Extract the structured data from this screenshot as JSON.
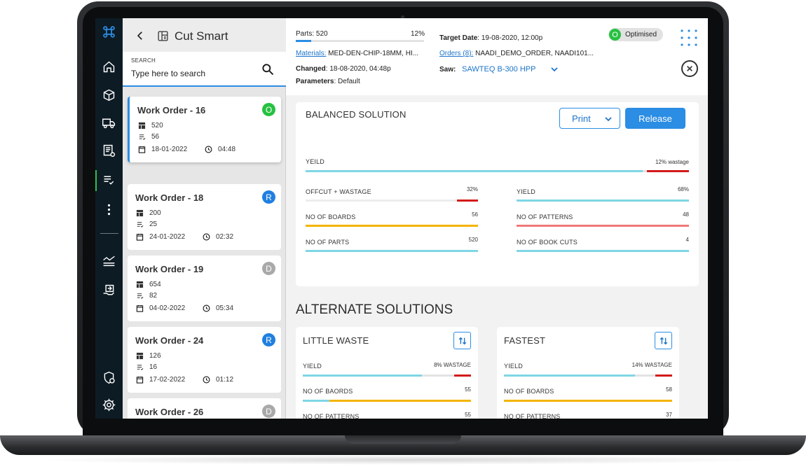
{
  "app": {
    "title": "Cut Smart",
    "search_caption": "SEARCH",
    "search_placeholder": "Type here to search"
  },
  "rail": {
    "items": [
      "app-logo-icon",
      "home-icon",
      "box-icon",
      "truck-icon",
      "report-icon",
      "checklist-icon",
      "more-icon",
      "analytics-icon",
      "handover-icon",
      "shield-icon",
      "settings-icon"
    ],
    "active": "checklist-icon"
  },
  "work_orders": [
    {
      "title": "Work Order - 16",
      "badge": "O",
      "badge_color": "#27c141",
      "boards": "520",
      "parts": "56",
      "date": "18-01-2022",
      "time": "04:48",
      "selected": true
    },
    {
      "title": "Work Order - 18",
      "badge": "R",
      "badge_color": "#1f7fe0",
      "boards": "200",
      "parts": "25",
      "date": "24-01-2022",
      "time": "02:32"
    },
    {
      "title": "Work Order - 19",
      "badge": "D",
      "badge_color": "#a9a9a9",
      "boards": "654",
      "parts": "82",
      "date": "04-02-2022",
      "time": "05:34"
    },
    {
      "title": "Work Order - 24",
      "badge": "R",
      "badge_color": "#1f7fe0",
      "boards": "126",
      "parts": "16",
      "date": "17-02-2022",
      "time": "01:12"
    },
    {
      "title": "Work Order - 26",
      "badge": "D",
      "badge_color": "#a9a9a9"
    }
  ],
  "header": {
    "parts_label": "Parts: 520",
    "parts_percent": "12%",
    "parts_progress": 0.12,
    "materials_label": "Materials:",
    "materials_value": "MED-DEN-CHIP-18MM, HI...",
    "changed_label": "Changed",
    "changed_value": ": 18-08-2020, 04:48p",
    "parameters_label": "Parameters",
    "parameters_value": ": Default",
    "target_label": "Target Date",
    "target_value": ": 19-08-2020, 12:00p",
    "orders_label": "Orders (8):",
    "orders_value": "NAADI_DEMO_ORDER, NAADI101...",
    "saw_label": "Saw:",
    "saw_value": "SAWTEQ B-300 HPP",
    "status_badge": "O",
    "status_label": "Optimised"
  },
  "balanced": {
    "title": "BALANCED SOLUTION",
    "print_label": "Print",
    "release_label": "Release",
    "yield_label": "YEILD",
    "yield_wastage": "12% wastage",
    "yield_progress": 0.88,
    "metrics_left": [
      {
        "label": "OFFCUT + WASTAGE",
        "value": "32%",
        "progress": 0.88,
        "color": "#ececec",
        "accent": "#d21b1b"
      },
      {
        "label": "NO OF BOARDS",
        "value": "56",
        "progress": 1.0,
        "color": "#f4b400"
      },
      {
        "label": "NO OF PARTS",
        "value": "520",
        "progress": 1.0,
        "color": "#7fd6e5"
      }
    ],
    "metrics_right": [
      {
        "label": "YIELD",
        "value": "68%",
        "progress": 1.0,
        "color": "#7fd6e5"
      },
      {
        "label": "NO OF PATTERNS",
        "value": "48",
        "progress": 1.0,
        "color": "#ee7a78"
      },
      {
        "label": "NO OF BOOK CUTS",
        "value": "4",
        "progress": 1.0,
        "color": "#7fd6e5"
      }
    ]
  },
  "alternate": {
    "heading": "ALTERNATE SOLUTIONS",
    "solutions": [
      {
        "title": "LITTLE WASTE",
        "yield_label": "YIELD",
        "wastage": "8% WASTAGE",
        "yield_progress": 0.71,
        "row2_label": "NO OF BAORDS",
        "row2_value": "55",
        "row3_label": "NO OF PATTERNS",
        "row3_value": "55"
      },
      {
        "title": "FASTEST",
        "yield_label": "YIELD",
        "wastage": "14% WASTAGE",
        "yield_progress": 0.78,
        "row2_label": "NO OF BOARDS",
        "row2_value": "58",
        "row3_label": "NO OF PATTERNS",
        "row3_value": "37"
      }
    ]
  },
  "colors": {
    "accent": "#2b8de3",
    "rail": "#0d1b24",
    "yield_bar": "#7fd6e5",
    "wastage": "#d21b1b",
    "boards_bar": "#f4b400",
    "patterns_bar": "#ee7a78"
  }
}
